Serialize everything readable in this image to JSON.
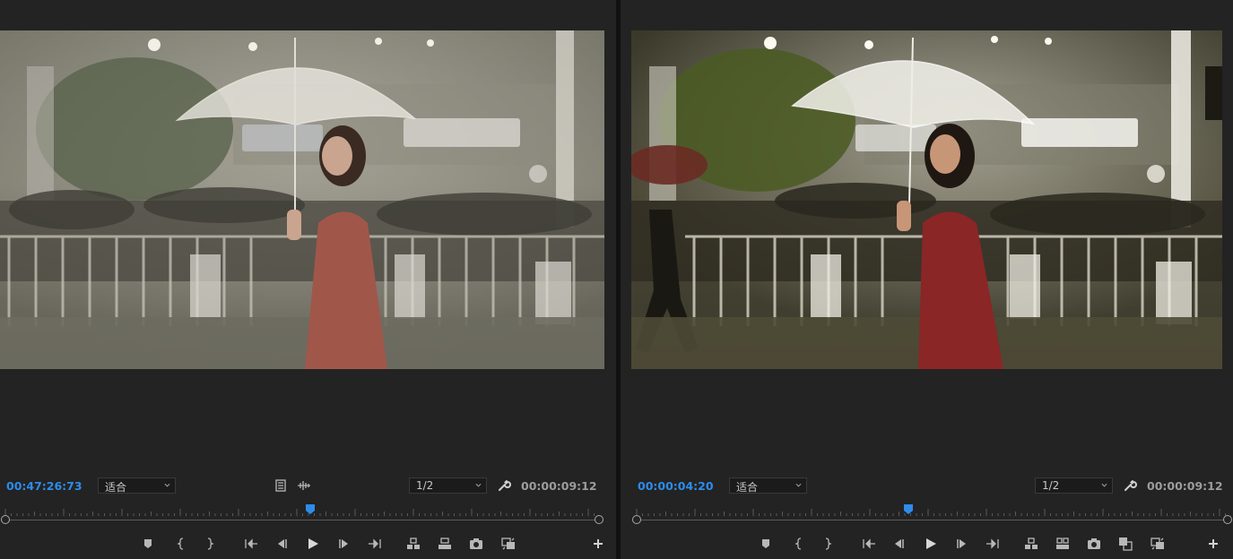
{
  "left_monitor": {
    "current_timecode": "00:47:26:73",
    "zoom_value": "适合",
    "resolution_value": "1/2",
    "duration_timecode": "00:00:09:12",
    "playhead_percent": 51.3
  },
  "right_monitor": {
    "current_timecode": "00:00:04:20",
    "zoom_value": "适合",
    "resolution_value": "1/2",
    "duration_timecode": "00:00:09:12",
    "playhead_percent": 46.0
  },
  "icons": {
    "marker": "marker-icon",
    "mark_in": "mark-in-icon",
    "mark_out": "mark-out-icon",
    "go_to_in": "go-to-in-icon",
    "step_back": "step-back-icon",
    "play": "play-icon",
    "step_forward": "step-forward-icon",
    "go_to_out": "go-to-out-icon",
    "lift": "lift-icon",
    "extract": "extract-icon",
    "export_frame": "camera-icon",
    "compare": "compare-icon",
    "comparison_view": "comparison-view-icon",
    "add_button": "plus-icon",
    "settings": "wrench-icon"
  },
  "colors": {
    "accent_blue": "#2d8ceb",
    "panel_bg": "#232323",
    "icon": "#b8b8b8"
  }
}
